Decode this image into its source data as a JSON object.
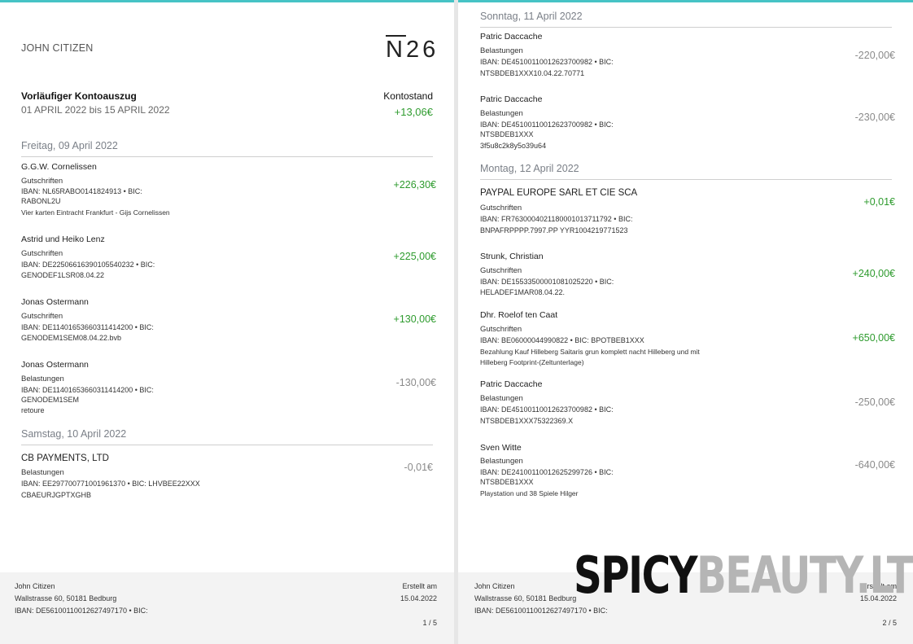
{
  "page1": {
    "owner": "JOHN CITIZEN",
    "logo": "N26",
    "statement_title": "Vorläufiger   Kontoauszug",
    "statement_range": "01 APRIL 2022 bis 15 APRIL 2022",
    "balance_label": "Kontostand",
    "balance_value": "+13,06€",
    "days": [
      {
        "date": "Freitag, 09 April 2022",
        "tx": [
          {
            "name": "G.G.W. Cornelissen",
            "type": "Gutschriften",
            "l1": "IBAN: NL65RABO0141824913 • BIC:",
            "l2": "RABONL2U",
            "note": "Vier karten Eintracht Frankfurt - Gijs Cornelissen",
            "amount": "+226,30€"
          },
          {
            "name": "Astrid und Heiko Lenz",
            "type": "Gutschriften",
            "l1": "IBAN: DE22506616390105540232 • BIC:",
            "l2": "GENODEF1LSR08.04.22",
            "amount": "+225,00€"
          },
          {
            "name": "Jonas Ostermann",
            "type": "Gutschriften",
            "l1": "IBAN: DE11401653660311414200 • BIC:",
            "l2": "GENODEM1SEM08.04.22.bvb",
            "amount": "+130,00€"
          },
          {
            "name": "Jonas Ostermann",
            "type": "Belastungen",
            "l1": "IBAN: DE11401653660311414200 • BIC:",
            "l2": "GENODEM1SEM",
            "l3": "retoure",
            "amount": "-130,00€"
          }
        ]
      },
      {
        "date": "Samstag, 10 April 2022",
        "tx": [
          {
            "name": "CB PAYMENTS, LTD",
            "type": "Belastungen",
            "l1": "IBAN: EE297700771001961370 • BIC: LHVBEE22XXX",
            "l2": "CBAEURJGPTXGHB",
            "amount": "-0,01€"
          }
        ]
      }
    ],
    "footer": {
      "name": "John Citizen",
      "address": "Wallstrasse 60, 50181 Bedburg",
      "iban": "IBAN:  DE56100110012627497170  •  BIC:",
      "created_label": "Erstellt am",
      "created_date": "15.04.2022",
      "page": "1 / 5"
    }
  },
  "page2": {
    "days": [
      {
        "date": "Sonntag, 11 April 2022",
        "tx": [
          {
            "name": "Patric Daccache",
            "type": "Belastungen",
            "l1": "IBAN: DE45100110012623700982 • BIC:",
            "l2": "NTSBDEB1XXX10.04.22.70771",
            "amount": "-220,00€"
          },
          {
            "name": "Patric Daccache",
            "type": "Belastungen",
            "l1": "IBAN: DE45100110012623700982 • BIC:",
            "l2": "NTSBDEB1XXX",
            "l3": "3f5u8c2k8y5o39u64",
            "amount": "-230,00€"
          }
        ]
      },
      {
        "date": "Montag, 12 April 2022",
        "tx": [
          {
            "name": "PAYPAL EUROPE SARL ET CIE SCA",
            "type": "Gutschriften",
            "l1": "IBAN: FR7630004021180001013711792 • BIC:",
            "l2": "BNPAFRPPPP.7997.PP YYR1004219771523",
            "amount": "+0,01€"
          },
          {
            "name": "Strunk, Christian",
            "type": "Gutschriften",
            "l1": "IBAN: DE15533500001081025220 • BIC:",
            "l2": "HELADEF1MAR08.04.22.",
            "amount": "+240,00€"
          },
          {
            "name": "Dhr. Roelof ten Caat",
            "type": "Gutschriften",
            "l1": "IBAN: BE06000044990822 • BIC: BPOTBEB1XXX",
            "l2": "Bezahlung Kauf Hilleberg Saitaris grun komplett nacht Hilleberg und mit",
            "l3": "Hilleberg Footprint-(Zeltunterlage)",
            "amount": "+650,00€"
          },
          {
            "name": "Patric Daccache",
            "type": "Belastungen",
            "l1": "IBAN: DE45100110012623700982 • BIC:",
            "l2": "NTSBDEB1XXX75322369.X",
            "amount": "-250,00€"
          },
          {
            "name": "Sven Witte",
            "type": "Belastungen",
            "l1": "IBAN: DE24100110012625299726 • BIC:",
            "l2": "NTSBDEB1XXX",
            "l3": "Playstation und 38 Spiele Hilger",
            "amount": "-640,00€"
          }
        ]
      }
    ],
    "footer": {
      "name": "John Citizen",
      "address": "Wallstrasse 60, 50181 Bedburg",
      "iban": "IBAN:  DE56100110012627497170  •  BIC:",
      "created_label": "Erstellt am",
      "created_date": "15.04.2022",
      "page": "2 / 5"
    }
  },
  "watermark": {
    "part_a": "SPICY",
    "part_b": "BEAUTY.LT"
  }
}
